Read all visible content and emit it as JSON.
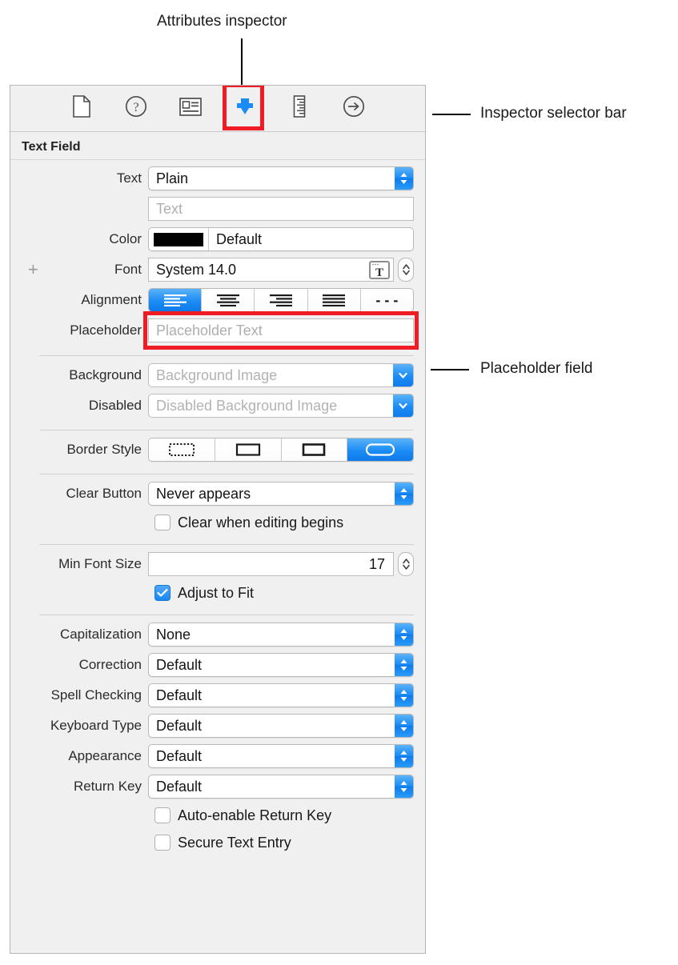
{
  "annotations": [
    {
      "id": "attributes-inspector",
      "label": "Attributes inspector"
    },
    {
      "id": "inspector-selector-bar",
      "label": "Inspector selector bar"
    },
    {
      "id": "placeholder-field",
      "label": "Placeholder field"
    }
  ],
  "colors": {
    "accent_blue": "#1b8cf5",
    "highlight_red": "#ee1c24",
    "panel_bg": "#f0f0f0",
    "text": "#1a1a1a"
  },
  "selector_bar": {
    "items": [
      {
        "icon": "file-inspector-icon",
        "name": "file-inspector",
        "selected": false
      },
      {
        "icon": "quick-help-inspector-icon",
        "name": "quick-help-inspector",
        "selected": false
      },
      {
        "icon": "identity-inspector-icon",
        "name": "identity-inspector",
        "selected": false
      },
      {
        "icon": "attributes-inspector-icon",
        "name": "attributes-inspector",
        "selected": true
      },
      {
        "icon": "size-inspector-icon",
        "name": "size-inspector",
        "selected": false
      },
      {
        "icon": "connections-inspector-icon",
        "name": "connections-inspector",
        "selected": false
      }
    ]
  },
  "panel": {
    "header": "Text Field",
    "rows": {
      "text": {
        "label": "Text",
        "value": "Plain"
      },
      "text_value": {
        "placeholder": "Text"
      },
      "color": {
        "label": "Color",
        "value": "Default",
        "swatch": "#000000"
      },
      "font": {
        "label": "Font",
        "value": "System 14.0",
        "plus": "+"
      },
      "alignment": {
        "label": "Alignment",
        "options": [
          "align-left",
          "align-center",
          "align-right",
          "align-justified",
          "align-natural"
        ],
        "selected_index": 0
      },
      "placeholder": {
        "label": "Placeholder",
        "placeholder": "Placeholder Text"
      },
      "background": {
        "label": "Background",
        "placeholder": "Background Image"
      },
      "disabled": {
        "label": "Disabled",
        "placeholder": "Disabled Background Image"
      },
      "border_style": {
        "label": "Border Style",
        "options": [
          "border-none",
          "border-line",
          "border-bezel",
          "border-rounded-rect"
        ],
        "selected_index": 3
      },
      "clear_button": {
        "label": "Clear Button",
        "value": "Never appears"
      },
      "clear_when_editing": {
        "label": "Clear when editing begins",
        "checked": false
      },
      "min_font_size": {
        "label": "Min Font Size",
        "value": "17"
      },
      "adjust_to_fit": {
        "label": "Adjust to Fit",
        "checked": true
      },
      "capitalization": {
        "label": "Capitalization",
        "value": "None"
      },
      "correction": {
        "label": "Correction",
        "value": "Default"
      },
      "spell_checking": {
        "label": "Spell Checking",
        "value": "Default"
      },
      "keyboard_type": {
        "label": "Keyboard Type",
        "value": "Default"
      },
      "appearance": {
        "label": "Appearance",
        "value": "Default"
      },
      "return_key": {
        "label": "Return Key",
        "value": "Default"
      },
      "auto_enable_return_key": {
        "label": "Auto-enable Return Key",
        "checked": false
      },
      "secure_text_entry": {
        "label": "Secure Text Entry",
        "checked": false
      }
    }
  }
}
